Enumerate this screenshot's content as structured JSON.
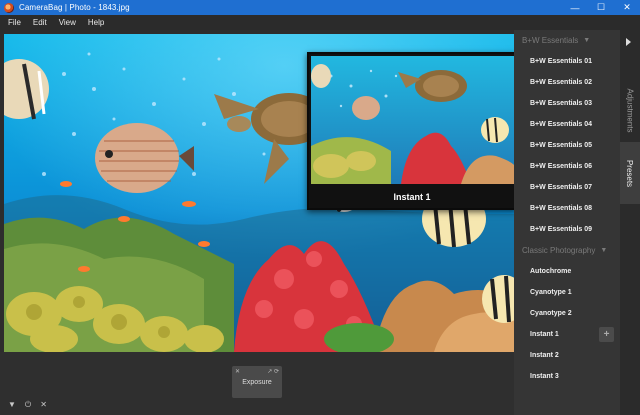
{
  "window": {
    "title": "CameraBag | Photo - 1843.jpg",
    "controls": [
      "—",
      "☐",
      "✕"
    ]
  },
  "menu": [
    "File",
    "Edit",
    "View",
    "Help"
  ],
  "preview": {
    "label": "Instant 1"
  },
  "adjustment_card": {
    "label": "Exposure",
    "close": "✕",
    "icons": "↗ ⟳"
  },
  "bottom_tools": [
    "▼",
    "⏻",
    "✕"
  ],
  "sidebar": {
    "sections": [
      {
        "title": "B+W Essentials",
        "items": [
          "B+W Essentials 01",
          "B+W Essentials 02",
          "B+W Essentials 03",
          "B+W Essentials 04",
          "B+W Essentials 05",
          "B+W Essentials 06",
          "B+W Essentials 07",
          "B+W Essentials 08",
          "B+W Essentials 09"
        ]
      },
      {
        "title": "Classic Photography",
        "items": [
          "Autochrome",
          "Cyanotype 1",
          "Cyanotype 2",
          "Instant 1",
          "Instant 2",
          "Instant 3"
        ]
      }
    ],
    "add_button": "+",
    "chevron": "▼"
  },
  "tabs": {
    "adjustments": "Adjustments",
    "presets": "Presets"
  },
  "colors": {
    "titlebar": "#1f6fd1",
    "panel": "#353535",
    "background": "#2d2d2d"
  }
}
